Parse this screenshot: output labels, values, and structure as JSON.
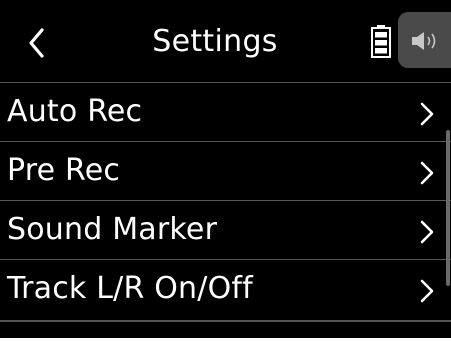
{
  "header": {
    "title": "Settings",
    "back_icon": "chevron-left-icon",
    "battery_icon": "battery-icon",
    "speaker_icon": "speaker-icon"
  },
  "menu": {
    "items": [
      {
        "label": "Auto Rec",
        "icon": "chevron-right-icon"
      },
      {
        "label": "Pre Rec",
        "icon": "chevron-right-icon"
      },
      {
        "label": "Sound Marker",
        "icon": "chevron-right-icon"
      },
      {
        "label": "Track L/R On/Off",
        "icon": "chevron-right-icon"
      }
    ]
  },
  "colors": {
    "background": "#000000",
    "text": "#ffffff",
    "divider": "#555555",
    "speaker_tab": "#4a4a4a"
  }
}
